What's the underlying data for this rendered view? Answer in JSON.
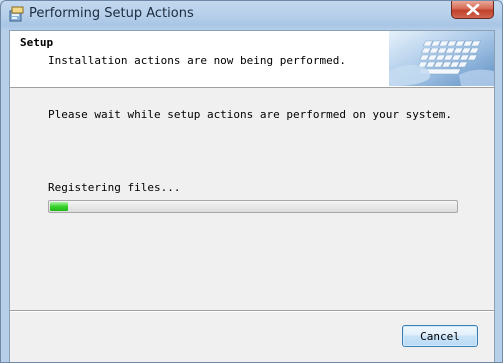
{
  "window": {
    "title": "Performing Setup Actions"
  },
  "banner": {
    "title": "Setup",
    "subtitle": "Installation actions are now being performed."
  },
  "main": {
    "info": "Please wait while setup actions are performed on your system.",
    "status": "Registering files...",
    "progress_percent": 5
  },
  "buttons": {
    "cancel": "Cancel"
  },
  "icons": {
    "app": "setup-package-icon",
    "close": "close-icon",
    "banner": "keyboard-image"
  },
  "colors": {
    "progress": "#37d22b",
    "close_button": "#c0412b"
  }
}
